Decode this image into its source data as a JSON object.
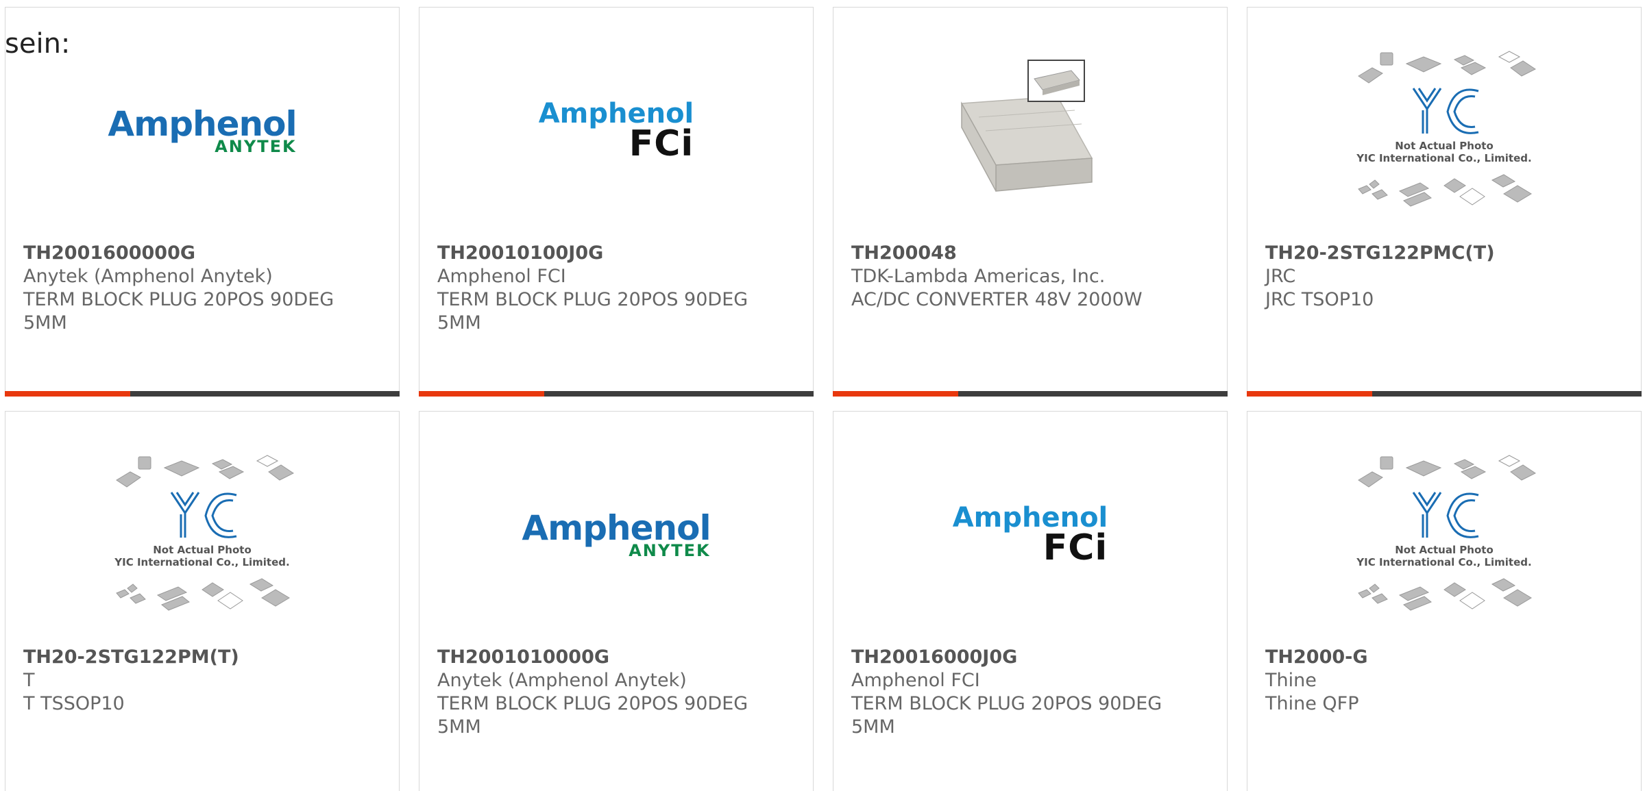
{
  "intro_text": "sein:",
  "products": [
    {
      "part_number": "TH2001600000G",
      "manufacturer": "Anytek (Amphenol Anytek)",
      "description_line1": "TERM BLOCK PLUG 20POS 90DEG",
      "description_line2": "5MM",
      "image": {
        "type": "logo-anytek",
        "brand": "Amphenol",
        "sub": "ANYTEK"
      }
    },
    {
      "part_number": "TH20010100J0G",
      "manufacturer": "Amphenol FCI",
      "description_line1": "TERM BLOCK PLUG 20POS 90DEG",
      "description_line2": "5MM",
      "image": {
        "type": "logo-fci",
        "brand": "Amphenol",
        "sub": "FCi"
      }
    },
    {
      "part_number": "TH200048",
      "manufacturer": "TDK-Lambda Americas, Inc.",
      "description_line1": "AC/DC CONVERTER 48V 2000W",
      "description_line2": "",
      "image": {
        "type": "photo-power-supply"
      }
    },
    {
      "part_number": "TH20-2STG122PMC(T)",
      "manufacturer": "JRC",
      "description_line1": "JRC TSOP10",
      "description_line2": "",
      "image": {
        "type": "placeholder-yic",
        "line1": "Not Actual Photo",
        "line2": "YIC International Co., Limited."
      }
    },
    {
      "part_number": "TH20-2STG122PM(T)",
      "manufacturer": "T",
      "description_line1": "T TSSOP10",
      "description_line2": "",
      "image": {
        "type": "placeholder-yic",
        "line1": "Not Actual Photo",
        "line2": "YIC International Co., Limited."
      }
    },
    {
      "part_number": "TH2001010000G",
      "manufacturer": "Anytek (Amphenol Anytek)",
      "description_line1": "TERM BLOCK PLUG 20POS 90DEG",
      "description_line2": "5MM",
      "image": {
        "type": "logo-anytek",
        "brand": "Amphenol",
        "sub": "ANYTEK"
      }
    },
    {
      "part_number": "TH20016000J0G",
      "manufacturer": "Amphenol FCI",
      "description_line1": "TERM BLOCK PLUG 20POS 90DEG",
      "description_line2": "5MM",
      "image": {
        "type": "logo-fci",
        "brand": "Amphenol",
        "sub": "FCi"
      }
    },
    {
      "part_number": "TH2000-G",
      "manufacturer": "Thine",
      "description_line1": "Thine QFP",
      "description_line2": "",
      "image": {
        "type": "placeholder-yic",
        "line1": "Not Actual Photo",
        "line2": "YIC International Co., Limited."
      }
    }
  ],
  "colors": {
    "accent": "#e8380e",
    "bar": "#3d3d3d",
    "text": "#666666"
  }
}
